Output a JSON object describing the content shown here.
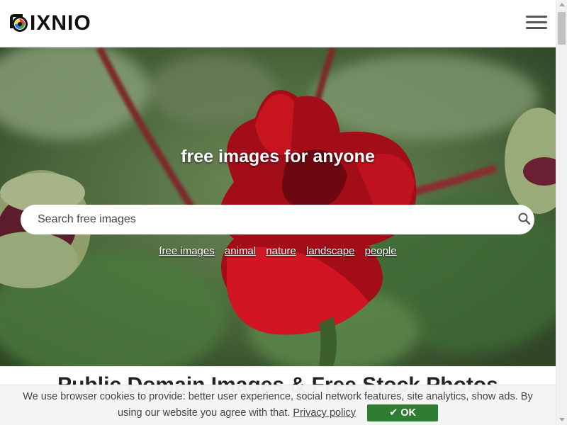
{
  "header": {
    "logo_text": "IXNIO",
    "menu_icon": "hamburger-menu-icon"
  },
  "hero": {
    "tagline": "free images for anyone",
    "search": {
      "placeholder": "Search free images",
      "value": "",
      "icon": "search-icon"
    },
    "tags": [
      "free images",
      "animal",
      "nature",
      "landscape",
      "people"
    ]
  },
  "main": {
    "heading": "Public Domain Images & Free Stock Photos"
  },
  "cookie_bar": {
    "text_line1": "We use browser cookies to provide: better user experience, social network features, site analytics, show ads. By",
    "text_line2": "using our website you agree with that.",
    "privacy_link": "Privacy policy",
    "ok_label": "✔ OK"
  },
  "colors": {
    "ok_button": "#2e7d32",
    "rose": "#b3101c"
  }
}
